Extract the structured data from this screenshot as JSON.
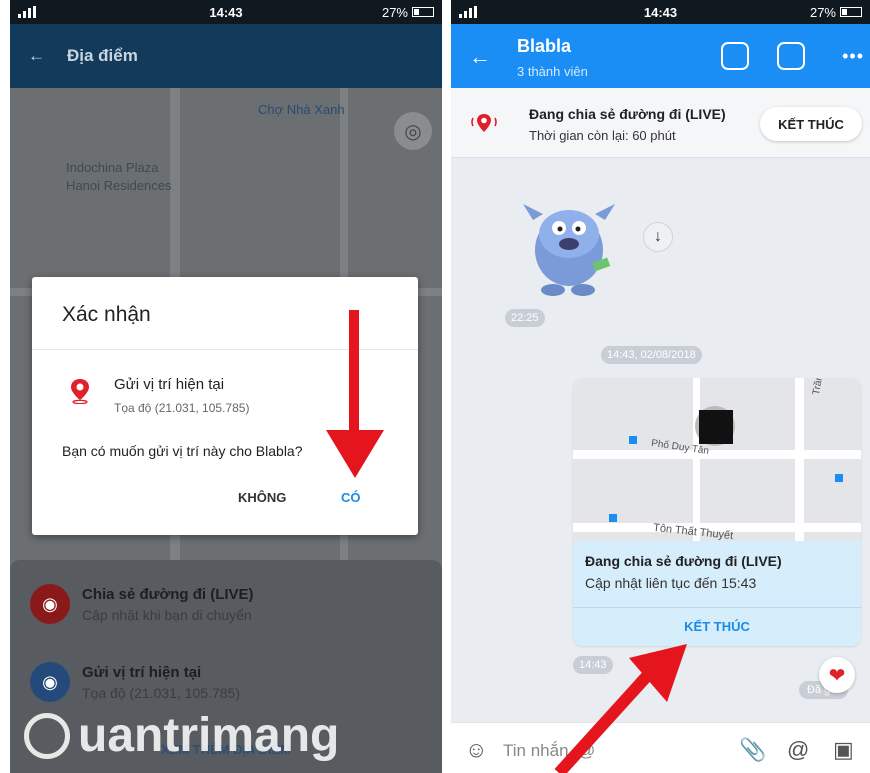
{
  "left": {
    "status": {
      "time": "14:43",
      "battery": "27%"
    },
    "appbar": {
      "title": "Địa điểm"
    },
    "map": {
      "labels": [
        "Chợ Nhà Xanh",
        "Indochina Plaza",
        "Hanoi Residences"
      ]
    },
    "dialog": {
      "title": "Xác nhận",
      "option_title": "Gửi vị trí hiện tại",
      "option_coords": "Tọa độ (21.031, 105.785)",
      "question": "Bạn có muốn gửi vị trí này cho Blabla?",
      "no_label": "KHÔNG",
      "yes_label": "CÓ"
    },
    "sheet": {
      "items": [
        {
          "title": "Chia sẻ đường đi (LIVE)",
          "subtitle": "Cập nhật khi bạn di chuyển"
        },
        {
          "title": "Gửi vị trí hiện tại",
          "subtitle": "Tọa độ (21.031, 105.785)"
        }
      ],
      "more_label": "XEM THÊM ĐỊA ĐIỂM"
    },
    "watermark": "uantrimang"
  },
  "right": {
    "status": {
      "time": "14:43",
      "battery": "27%"
    },
    "appbar": {
      "name": "Blabla",
      "members": "3 thành viên"
    },
    "live_banner": {
      "title": "Đang chia sẻ đường đi (LIVE)",
      "subtitle": "Thời gian còn lại: 60 phút",
      "end_label": "KẾT THÚC"
    },
    "chat": {
      "sticker_time": "22:25",
      "date_separator": "14:43, 02/08/2018",
      "card": {
        "map_labels": [
          "Phố Duy Tân",
          "Tôn Thất Thuyết",
          "Trần Thái"
        ],
        "title": "Đang chia sẻ đường đi (LIVE)",
        "subtitle": "Cập nhật liên tục đến 15:43",
        "end_label": "KẾT THÚC"
      },
      "card_time": "14:43",
      "sent_label": "Đã gửi"
    },
    "composer": {
      "placeholder": "Tin nhắn, @"
    }
  },
  "colors": {
    "zalo_blue": "#1a8ef5",
    "live_red": "#e0202b",
    "end_text_blue": "#1a8be6"
  },
  "icons": [
    "back-arrow-icon",
    "location-pin-icon",
    "gps-icon",
    "camera-icon",
    "gallery-icon",
    "more-icon",
    "download-icon",
    "heart-icon",
    "emoji-icon",
    "attach-icon",
    "mention-icon",
    "image-icon"
  ]
}
